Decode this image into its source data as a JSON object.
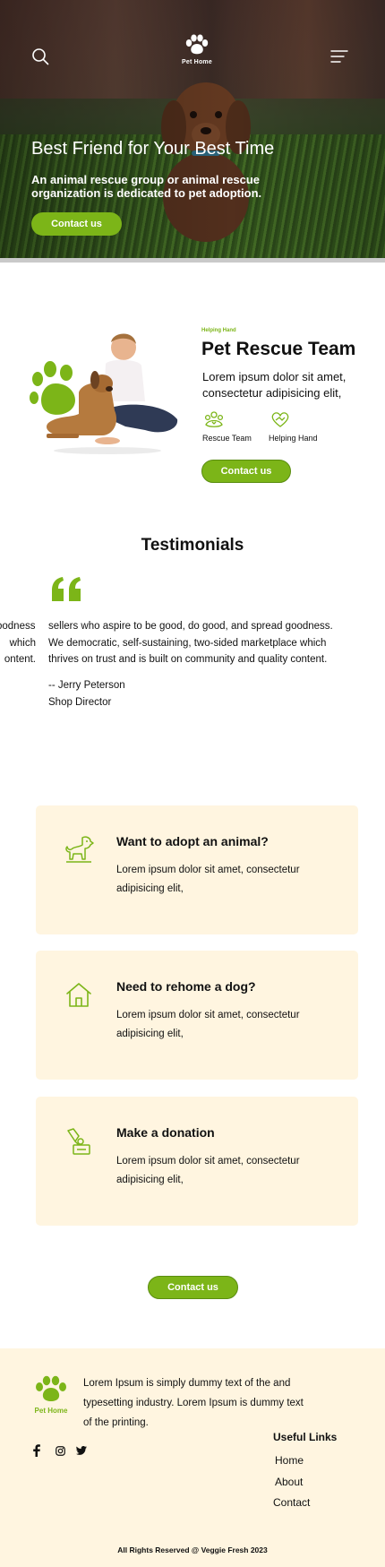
{
  "brand": {
    "name": "Pet Home",
    "accent_color": "#7cb518",
    "cream_color": "#fff5e0"
  },
  "header": {
    "search_icon": "search-icon",
    "menu_icon": "hamburger-menu-icon",
    "logo_icon": "paw-icon"
  },
  "hero": {
    "title": "Best Friend for Your Best Time",
    "subtitle": "An animal rescue group or animal rescue organization is dedicated to pet adoption.",
    "button_label": "Contact us"
  },
  "rescue": {
    "tag": "Helping Hand",
    "title": "Pet Rescue Team",
    "text": "Lorem ipsum dolor sit amet, consectetur adipisicing elit,",
    "features": [
      {
        "icon": "rescue-team-icon",
        "label": "Rescue Team"
      },
      {
        "icon": "helping-hand-icon",
        "label": "Helping Hand"
      }
    ],
    "button_label": "Contact us"
  },
  "testimonials": {
    "title": "Testimonials",
    "quote_icon": "quote-icon",
    "prev_slide_lines": [
      "oodness.",
      "which",
      "ontent."
    ],
    "lines": [
      "sellers who aspire to be good, do good, and spread goodness.",
      "We democratic, self-sustaining, two-sided marketplace which",
      "thrives on trust and is built on community and quality content."
    ],
    "author": "-- Jerry Peterson",
    "role": "Shop Director"
  },
  "cards": [
    {
      "icon": "dog-icon",
      "title": "Want to adopt an animal?",
      "text": "Lorem ipsum dolor sit amet, consectetur adipisicing elit,"
    },
    {
      "icon": "house-icon",
      "title": "Need to rehome a dog?",
      "text": "Lorem ipsum dolor sit amet, consectetur adipisicing elit,"
    },
    {
      "icon": "donation-icon",
      "title": "Make a donation",
      "text": "Lorem ipsum dolor sit amet, consectetur adipisicing elit,"
    }
  ],
  "cta": {
    "button_label": "Contact us"
  },
  "footer": {
    "logo_text": "Pet Home",
    "about": "Lorem Ipsum is simply dummy text of the and typesetting industry. Lorem Ipsum is dummy text of the printing.",
    "social": [
      "facebook-icon",
      "instagram-icon",
      "twitter-icon"
    ],
    "links_title": "Useful Links",
    "links": [
      "Home",
      "About",
      "Contact"
    ],
    "copyright": "All Rights Reserved @ Veggie Fresh 2023"
  }
}
